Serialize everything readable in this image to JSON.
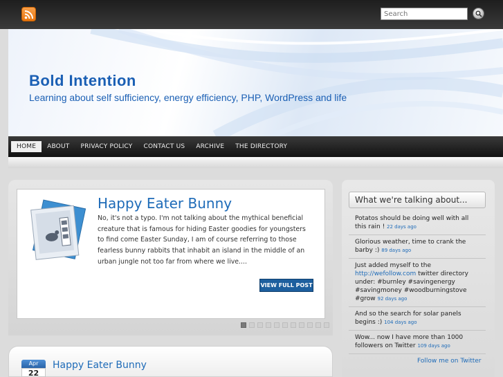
{
  "top": {
    "rss_icon": "rss-feed-icon",
    "search_placeholder": "Search",
    "search_icon": "magnifier-icon"
  },
  "header": {
    "site_title": "Bold Intention",
    "tagline": "Learning about self sufficiency, energy efficiency, PHP, WordPress and life"
  },
  "nav": {
    "items": [
      "HOME",
      "ABOUT",
      "PRIVACY POLICY",
      "CONTACT US",
      "ARCHIVE",
      "THE DIRECTORY"
    ],
    "active": "HOME"
  },
  "featured": {
    "title": "Happy Eater Bunny",
    "excerpt": "No, it's not a typo. I'm not talking about the mythical beneficial creature that is famous for hiding Easter goodies for youngsters to find come Easter Sunday, I am of course referring to those fearless bunny rabbits that inhabit an island in the middle of an urban jungle not too far from where we live....",
    "button_label": "VIEW FULL POST",
    "image_icon": "photo-stack-icon",
    "slide_count": 11,
    "active_slide": 1
  },
  "post": {
    "month": "Apr",
    "day": "22",
    "title": "Happy Eater Bunny"
  },
  "sidebar": {
    "widget_title": "What we're talking about...",
    "tweets": [
      {
        "text": "Potatos should be doing well with all this rain ! ",
        "link": "",
        "after": "",
        "ago": "22 days ago"
      },
      {
        "text": "Glorious weather, time to crank the barby :) ",
        "link": "",
        "after": "",
        "ago": "89 days ago"
      },
      {
        "text": "Just added myself to the ",
        "link": "http://wefollow.com",
        "after": " twitter directory under: #burnley #savingenergy #savingmoney #woodburningstove #grow ",
        "ago": "92 days ago"
      },
      {
        "text": "And so the search for solar panels begins :) ",
        "link": "",
        "after": "",
        "ago": "104 days ago"
      },
      {
        "text": "Wow... now I have more than 1000 followers on Twitter ",
        "link": "",
        "after": "",
        "ago": "109 days ago"
      }
    ],
    "follow_label": "Follow me on Twitter"
  },
  "colors": {
    "accent": "#1e6bb8",
    "button": "#1d5f9e",
    "nav_bg": "#1a1a1a"
  }
}
